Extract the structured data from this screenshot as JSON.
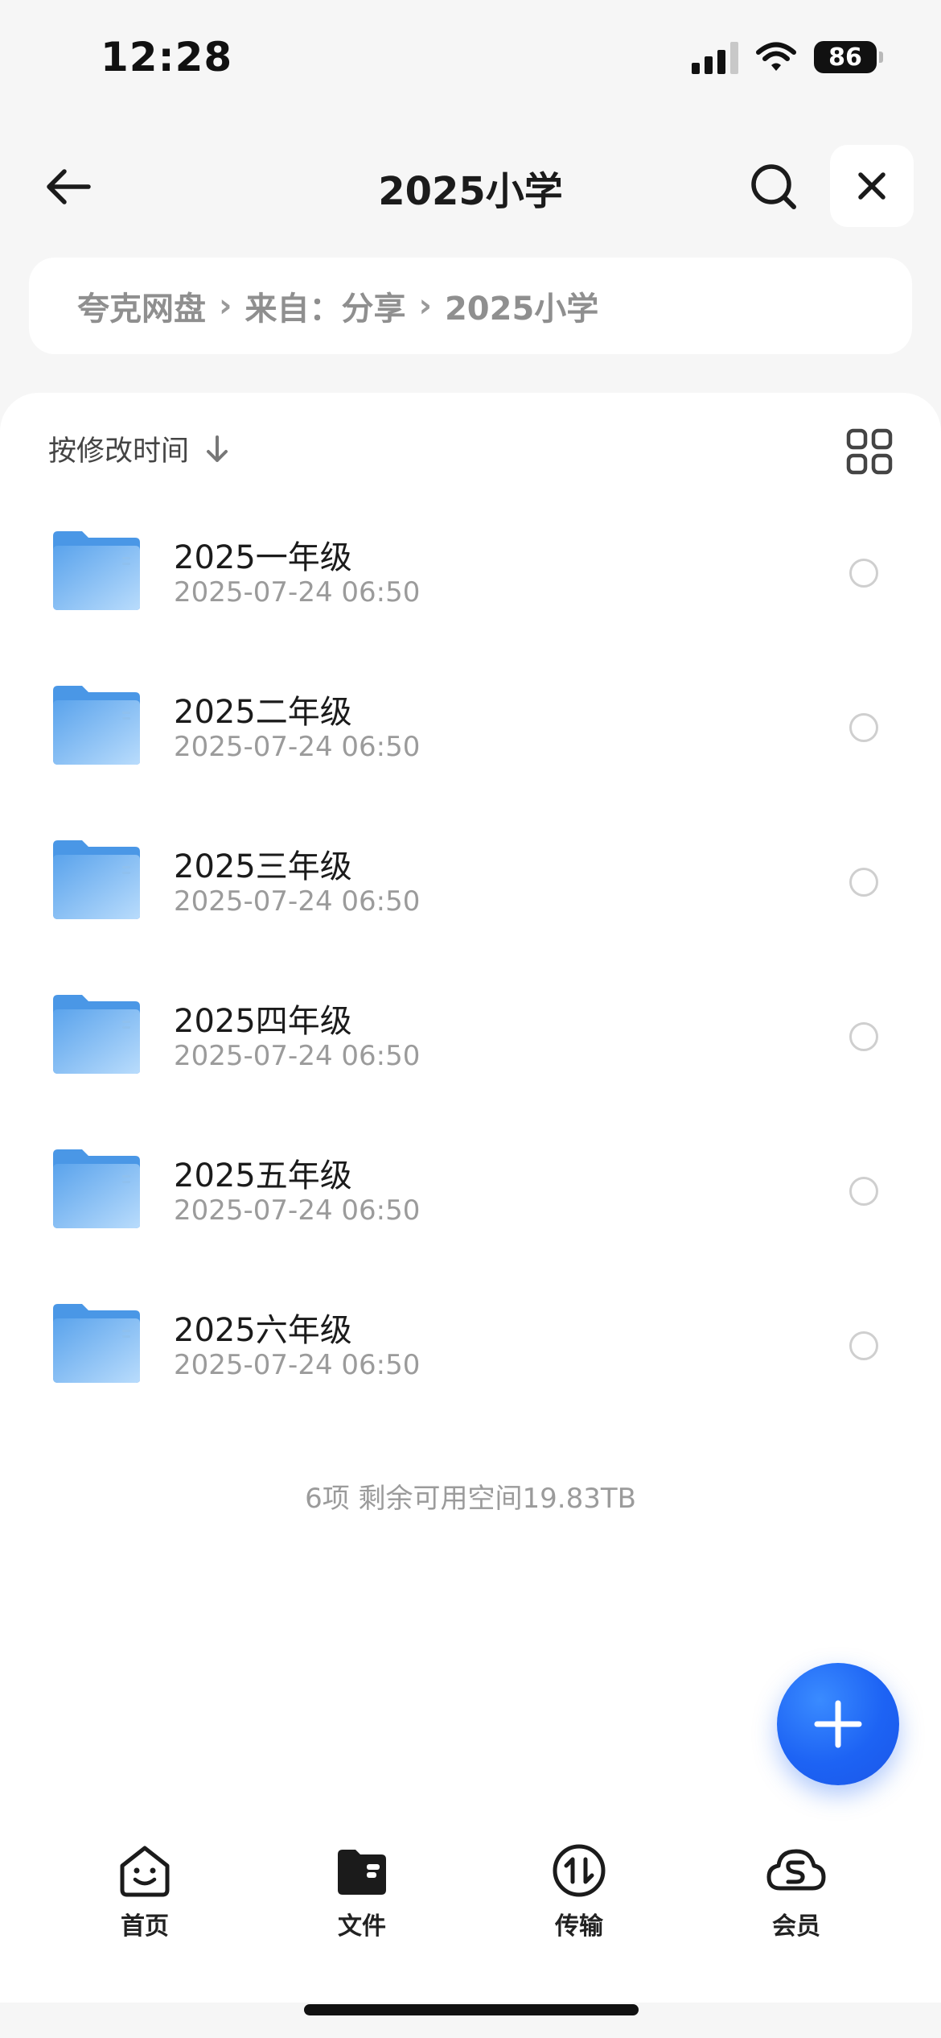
{
  "status_bar": {
    "time": "12:28",
    "battery": "86"
  },
  "header": {
    "title": "2025小学"
  },
  "breadcrumb": {
    "items": [
      "夸克网盘",
      "来自：分享",
      "2025小学"
    ],
    "separator": "›"
  },
  "toolbar": {
    "sort_label": "按修改时间"
  },
  "files": [
    {
      "name": "2025一年级",
      "date": "2025-07-24 06:50"
    },
    {
      "name": "2025二年级",
      "date": "2025-07-24 06:50"
    },
    {
      "name": "2025三年级",
      "date": "2025-07-24 06:50"
    },
    {
      "name": "2025四年级",
      "date": "2025-07-24 06:50"
    },
    {
      "name": "2025五年级",
      "date": "2025-07-24 06:50"
    },
    {
      "name": "2025六年级",
      "date": "2025-07-24 06:50"
    }
  ],
  "summary": "6项 剩余可用空间19.83TB",
  "tabs": [
    {
      "label": "首页",
      "icon": "home-face-icon"
    },
    {
      "label": "文件",
      "icon": "folder-icon"
    },
    {
      "label": "传输",
      "icon": "transfer-icon"
    },
    {
      "label": "会员",
      "icon": "membership-cloud-icon"
    }
  ],
  "colors": {
    "accent": "#1d63f4",
    "folder": "#6fb2f2",
    "background": "#f6f6f6"
  }
}
